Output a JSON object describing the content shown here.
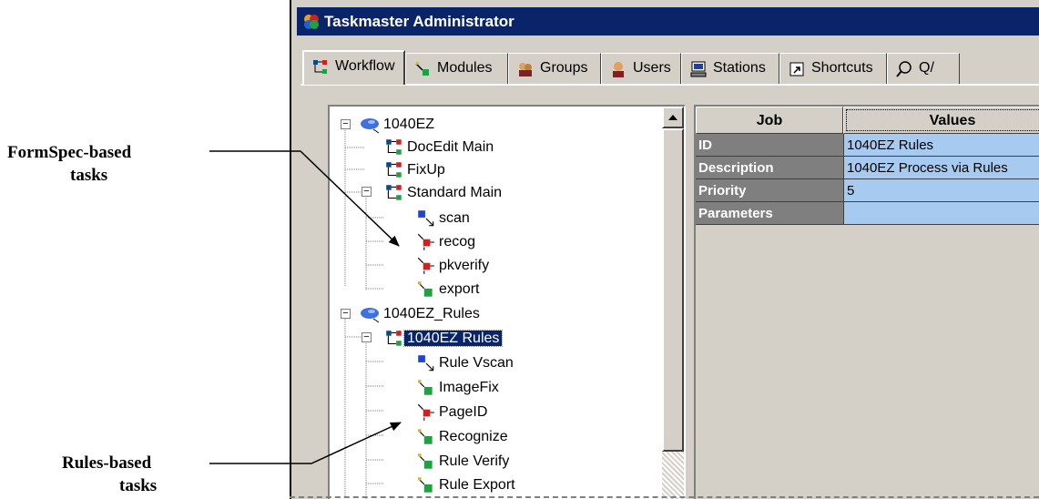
{
  "annotations": {
    "formspec_line1": "FormSpec-based",
    "formspec_line2": "tasks",
    "rules_line1": "Rules-based",
    "rules_line2": "tasks"
  },
  "window": {
    "title": "Taskmaster Administrator",
    "icon": "app-logo-icon"
  },
  "tabs": [
    {
      "label": "Workflow",
      "icon": "workflow-icon",
      "active": true
    },
    {
      "label": "Modules",
      "icon": "modules-icon"
    },
    {
      "label": "Groups",
      "icon": "groups-icon"
    },
    {
      "label": "Users",
      "icon": "user-icon"
    },
    {
      "label": "Stations",
      "icon": "stations-icon"
    },
    {
      "label": "Shortcuts",
      "icon": "shortcut-icon"
    },
    {
      "label": "Q/",
      "icon": "search-icon"
    }
  ],
  "tree": {
    "nodes": [
      {
        "label": "1040EZ",
        "icon": "application-icon",
        "expanded": true
      },
      {
        "label": "DocEdit Main",
        "icon": "job-icon"
      },
      {
        "label": "FixUp",
        "icon": "job-icon"
      },
      {
        "label": "Standard Main",
        "icon": "job-icon",
        "expanded": true
      },
      {
        "label": "scan",
        "icon": "scan-task-icon"
      },
      {
        "label": "recog",
        "icon": "red-task-icon"
      },
      {
        "label": "pkverify",
        "icon": "red-task-icon"
      },
      {
        "label": "export",
        "icon": "green-task-icon"
      },
      {
        "label": "1040EZ_Rules",
        "icon": "application-icon",
        "expanded": true
      },
      {
        "label": "1040EZ Rules",
        "icon": "job-icon",
        "expanded": true,
        "selected": true
      },
      {
        "label": "Rule Vscan",
        "icon": "scan-task-icon"
      },
      {
        "label": "ImageFix",
        "icon": "green-task-icon"
      },
      {
        "label": "PageID",
        "icon": "red-task-icon"
      },
      {
        "label": "Recognize",
        "icon": "green-task-icon"
      },
      {
        "label": "Rule Verify",
        "icon": "green-task-icon"
      },
      {
        "label": "Rule Export",
        "icon": "green-task-icon"
      }
    ]
  },
  "grid": {
    "headers": [
      "Job",
      "Values"
    ],
    "rows": [
      {
        "key": "ID",
        "value": "1040EZ Rules"
      },
      {
        "key": "Description",
        "value": "1040EZ Process via Rules"
      },
      {
        "key": "Priority",
        "value": "5"
      },
      {
        "key": "Parameters",
        "value": ""
      }
    ]
  },
  "colors": {
    "titlebar": "#0a246a",
    "selection": "#0a246a",
    "value_cell": "#a6caf0",
    "key_cell": "#7f7f7f"
  }
}
